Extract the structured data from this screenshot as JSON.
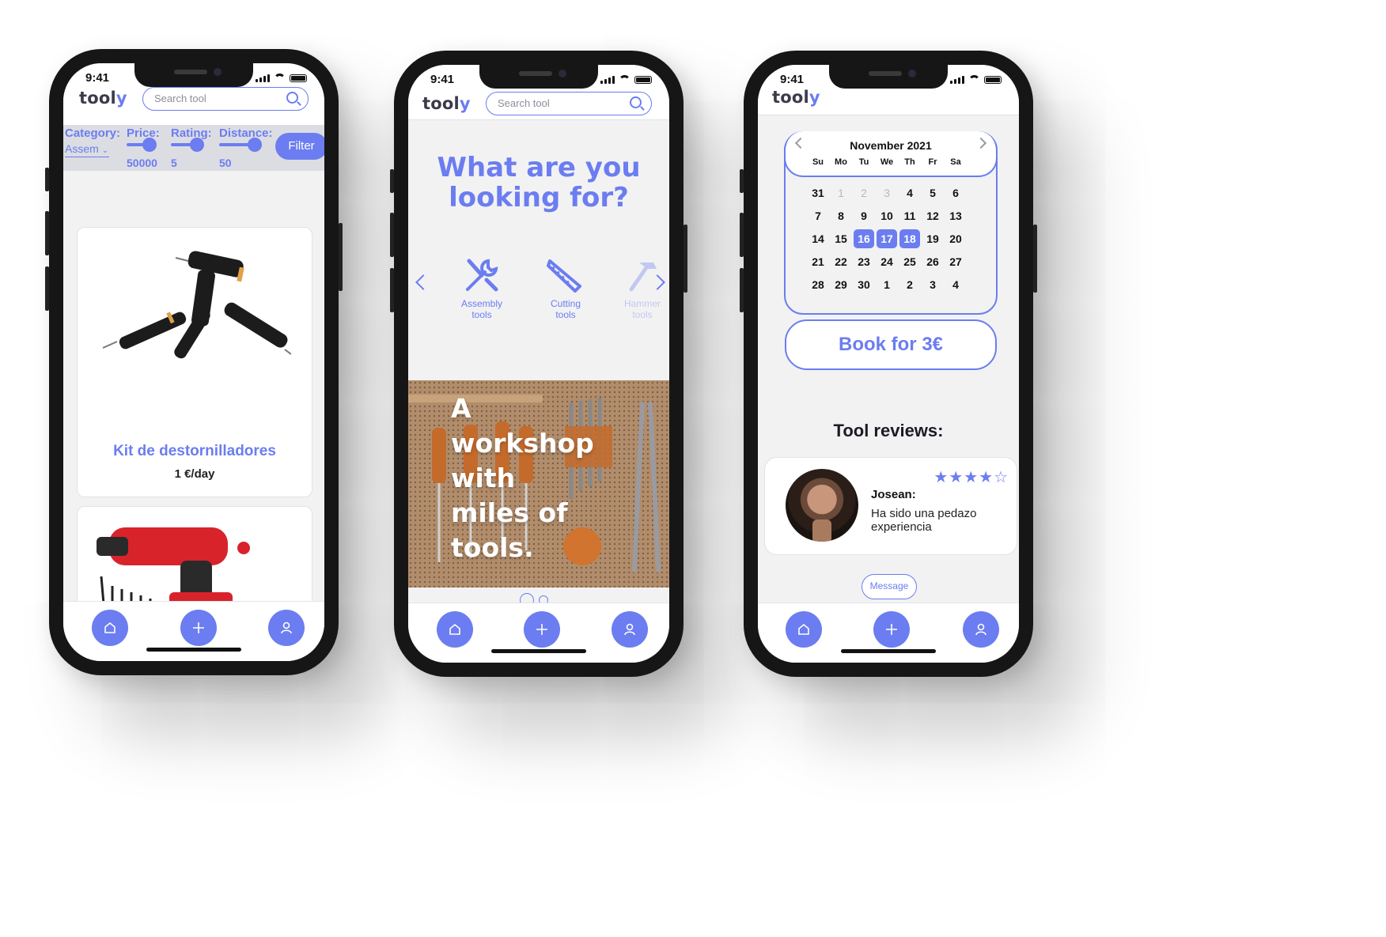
{
  "status": {
    "time": "9:41"
  },
  "brand": {
    "name_main": "tool",
    "name_accent": "y"
  },
  "search": {
    "placeholder": "Search tool"
  },
  "colors": {
    "accent": "#6b7df0",
    "screen_bg": "#f2f2f3",
    "dark": "#161616"
  },
  "tabbar": {
    "icons": [
      "home-icon",
      "plus-icon",
      "user-icon"
    ]
  },
  "phone1": {
    "filters": {
      "category_label": "Category:",
      "category_value": "Assem",
      "price_label": "Price:",
      "price_value": "50000",
      "rating_label": "Rating:",
      "rating_value": "5",
      "distance_label": "Distance:",
      "distance_value": "50",
      "filter_button": "Filter"
    },
    "listings": [
      {
        "title": "Kit de destornilladores",
        "price": "1 €/day"
      },
      {
        "title": "",
        "price": ""
      }
    ]
  },
  "phone2": {
    "headline_line1": "What are you",
    "headline_line2": "looking for?",
    "categories": [
      {
        "line1": "Assembly",
        "line2": "tools",
        "icon": "wrench-screwdriver-icon"
      },
      {
        "line1": "Cutting",
        "line2": "tools",
        "icon": "saw-icon"
      },
      {
        "line1": "Hammer",
        "line2": "tools",
        "icon": "hammer-icon"
      }
    ],
    "banner": {
      "line1": "A",
      "line2": "workshop",
      "line3": "with",
      "line4": "miles of",
      "line5": "tools."
    },
    "carousel": {
      "pages": 2,
      "active": 1
    }
  },
  "phone3": {
    "calendar": {
      "month": "November 2021",
      "weekdays": [
        "Su",
        "Mo",
        "Tu",
        "We",
        "Th",
        "Fr",
        "Sa"
      ],
      "weeks": [
        [
          "31",
          "1",
          "2",
          "3",
          "4",
          "5",
          "6"
        ],
        [
          "7",
          "8",
          "9",
          "10",
          "11",
          "12",
          "13"
        ],
        [
          "14",
          "15",
          "16",
          "17",
          "18",
          "19",
          "20"
        ],
        [
          "21",
          "22",
          "23",
          "24",
          "25",
          "26",
          "27"
        ],
        [
          "28",
          "29",
          "30",
          "1",
          "2",
          "3",
          "4"
        ]
      ],
      "muted": [
        "0-1",
        "0-2",
        "0-3"
      ],
      "selected": [
        "2-2",
        "2-3",
        "2-4"
      ]
    },
    "book_button": "Book for 3€",
    "reviews_title": "Tool reviews:",
    "review": {
      "name": "Josean:",
      "text": "Ha sido una pedazo experiencia",
      "stars": 4,
      "max_stars": 5
    },
    "message_button": "Message"
  }
}
